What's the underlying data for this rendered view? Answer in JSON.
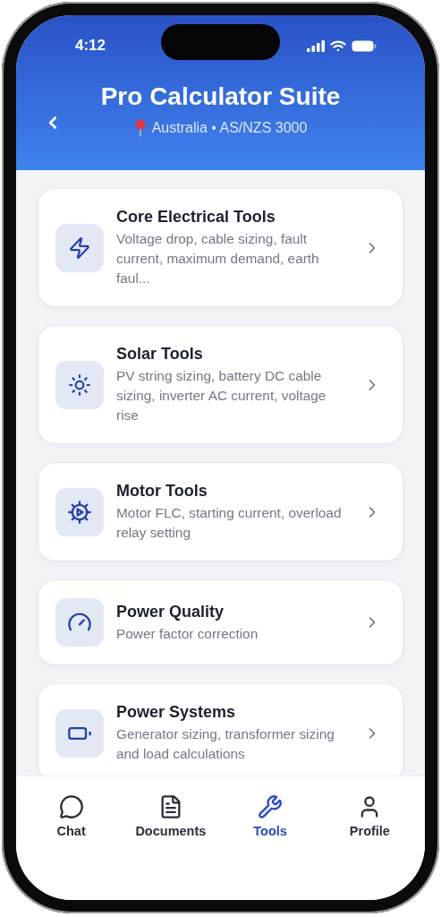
{
  "status_bar": {
    "time": "4:12"
  },
  "header": {
    "title": "Pro Calculator Suite",
    "subtitle": "Australia • AS/NZS 3000"
  },
  "categories": [
    {
      "title": "Core Electrical Tools",
      "description": "Voltage drop, cable sizing, fault current, maximum demand, earth faul..."
    },
    {
      "title": "Solar Tools",
      "description": "PV string sizing, battery DC cable sizing, inverter AC current, voltage rise"
    },
    {
      "title": "Motor Tools",
      "description": "Motor FLC, starting current, overload relay setting"
    },
    {
      "title": "Power Quality",
      "description": "Power factor correction"
    },
    {
      "title": "Power Systems",
      "description": "Generator sizing, transformer sizing and load calculations"
    }
  ],
  "tab_bar": [
    {
      "label": "Chat",
      "selected": false
    },
    {
      "label": "Documents",
      "selected": false
    },
    {
      "label": "Tools",
      "selected": true
    },
    {
      "label": "Profile",
      "selected": false
    }
  ]
}
